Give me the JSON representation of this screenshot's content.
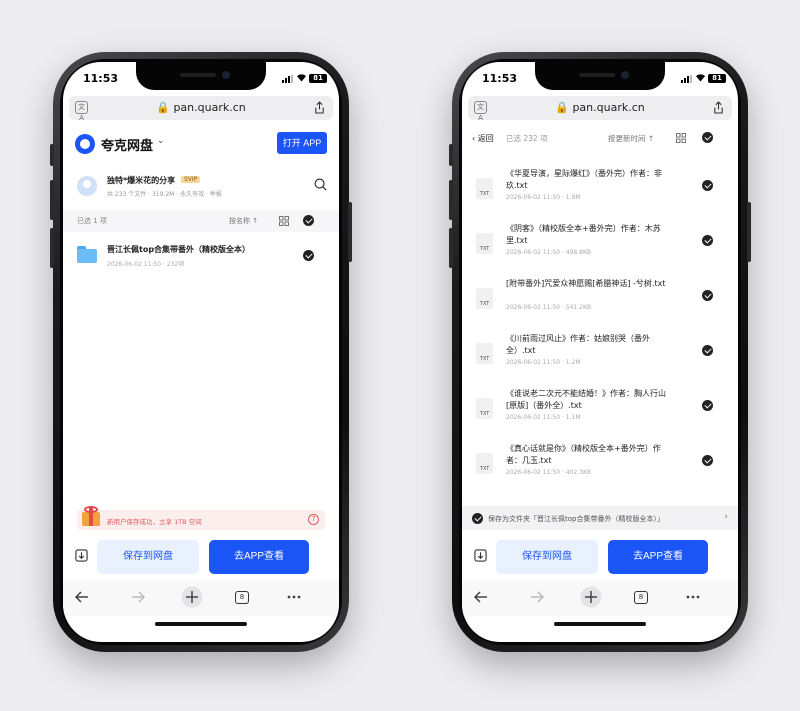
{
  "status": {
    "time": "11:53",
    "battery": "81"
  },
  "browser": {
    "url": "pan.quark.cn",
    "translate_glyph": "文A",
    "tabs_count": "8"
  },
  "left": {
    "app_name": "夸克网盘",
    "app_name_arrow": "⌄",
    "open_app": "打开 APP",
    "share_title": "独特*爆米花的分享",
    "share_badge": "SVIP",
    "share_meta": "共 233 个文件 · 319.2M · 永久有效 · 举报",
    "selected": "已选 1 项",
    "sort_label": "按名称 ↑",
    "folder": {
      "name": "晋江长佩top合集带番外（精校版全本）",
      "meta": "2026-06-02 11:50 · 232项"
    },
    "promo": "新用户保存成功，立享 1TB 空间",
    "promo_help": "?",
    "save_button": "保存到网盘",
    "go_button": "去APP查看"
  },
  "right": {
    "back": "‹ 返回",
    "selected": "已选 232 项",
    "sort_label": "按更新时间 ↑",
    "txt_label": "TXT",
    "files": [
      {
        "name": "《华夏导演，星际爆红》（番外完）作者：非玖.txt",
        "meta": "2026-06-02 11:50 · 1.9M"
      },
      {
        "name": "《阴客》（精校版全本+番外完）作者：木苏里.txt",
        "meta": "2026-06-02 11:50 · 498.8KB"
      },
      {
        "name": "[附带番外]咒爱众神愿赐[希腊神话] -兮树.txt",
        "meta": "2026-06-02 11:50 · 541.2KB"
      },
      {
        "name": "《川前雨过风止》作者：姑娘别哭（番外全）.txt",
        "meta": "2026-06-02 11:50 · 1.2M"
      },
      {
        "name": "《谁说老二次元不能结婚！》作者：胸人行山[原版]（番外全）.txt",
        "meta": "2026-06-02 11:50 · 1.1M"
      },
      {
        "name": "《真心话就是你》（精校版全本+番外完）作者：几玉.txt",
        "meta": "2026-06-02 11:50 · 402.3KB"
      }
    ],
    "save_as": "保存为文件夹「晋江长佩top合集带番外（精校版全本）」",
    "save_as_chevron": "›",
    "save_button": "保存到网盘",
    "go_button": "去APP查看"
  },
  "colors": {
    "accent": "#1b55f5",
    "accent_light": "#e9f0fe",
    "promo_red": "#e05a5a"
  }
}
